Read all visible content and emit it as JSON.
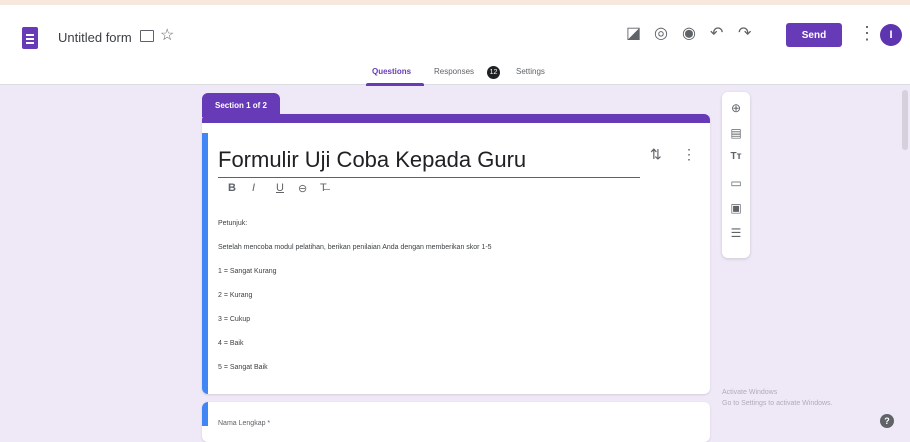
{
  "header": {
    "doc_title": "Untitled form",
    "send_label": "Send",
    "avatar_initial": "I"
  },
  "tabs": {
    "questions": "Questions",
    "responses": "Responses",
    "responses_count": "12",
    "settings": "Settings"
  },
  "section_label": "Section 1 of 2",
  "form": {
    "title": "Formulir Uji Coba Kepada Guru",
    "format_buttons": [
      "B",
      "I",
      "U",
      "⊖",
      "T̶"
    ],
    "description": [
      "Petunjuk:",
      "Setelah mencoba modul pelatihan, berikan penilaian Anda dengan memberikan skor 1-5",
      "1 = Sangat Kurang",
      "2 = Kurang",
      "3 = Cukup",
      "4 = Baik",
      "5 = Sangat Baik"
    ]
  },
  "next_card_text": "Nama Lengkap *",
  "watermark": {
    "line1": "Activate Windows",
    "line2": "Go to Settings to activate Windows."
  },
  "colors": {
    "accent": "#673ab7",
    "focus": "#4285f4",
    "background": "#efe9f7"
  }
}
